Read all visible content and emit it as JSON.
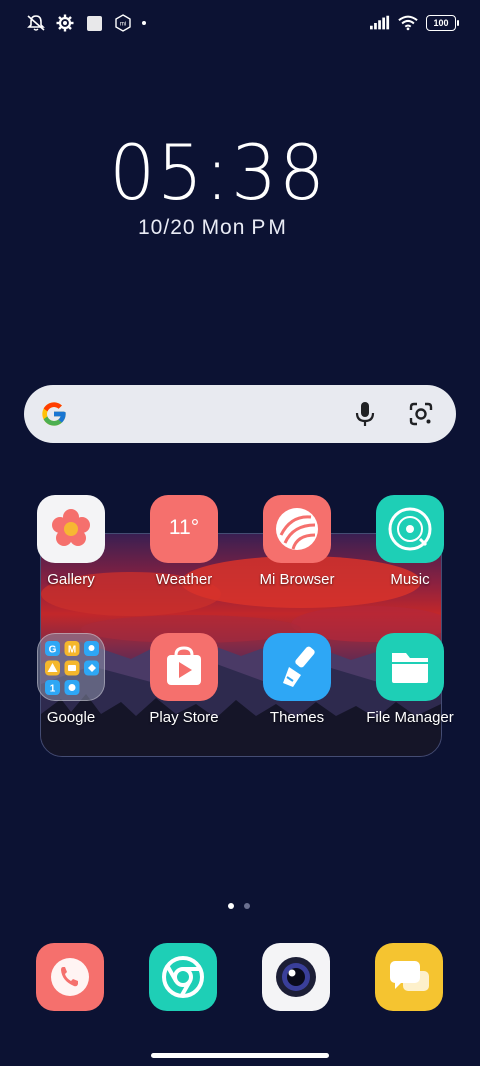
{
  "status_bar": {
    "battery": "100",
    "left_icons": [
      "notifications-muted-icon",
      "settings-gear-icon",
      "square-notification-icon",
      "mi-account-icon"
    ],
    "right_icons": [
      "cellular-signal-icon",
      "wifi-icon",
      "battery-icon"
    ]
  },
  "clock": {
    "time": "05:38",
    "date": "10/20",
    "day": "Mon",
    "period": "PM"
  },
  "search": {
    "icons": [
      "google-g-icon",
      "microphone-icon",
      "google-lens-icon"
    ]
  },
  "apps": [
    {
      "label": "Gallery",
      "icon": "gallery-flower-icon",
      "color": "#f4f4f6"
    },
    {
      "label": "Weather",
      "icon": "weather-icon",
      "color": "#f5706d",
      "value": "11°"
    },
    {
      "label": "Mi Browser",
      "icon": "browser-icon",
      "color": "#f5706d"
    },
    {
      "label": "Music",
      "icon": "music-disc-icon",
      "color": "#1ecfb6"
    },
    {
      "label": "Google",
      "icon": "folder-icon",
      "color": "#8c8fa8"
    },
    {
      "label": "Play Store",
      "icon": "play-store-icon",
      "color": "#f5706d"
    },
    {
      "label": "Themes",
      "icon": "brush-icon",
      "color": "#2ea7f5"
    },
    {
      "label": "File Manager",
      "icon": "folder-file-icon",
      "color": "#1ecfb6"
    }
  ],
  "dock": [
    {
      "name": "phone",
      "icon": "phone-icon",
      "color": "#f5706d"
    },
    {
      "name": "chrome",
      "icon": "chrome-icon",
      "color": "#1ecfb6"
    },
    {
      "name": "camera",
      "icon": "camera-icon",
      "color": "#f4f4f6"
    },
    {
      "name": "messages",
      "icon": "message-icon",
      "color": "#f5c430"
    }
  ],
  "pages": {
    "count": 2,
    "active": 1
  },
  "colors": {
    "background": "#0c1233",
    "coral": "#f5706d",
    "teal": "#1ecfb6",
    "blue": "#2ea7f5",
    "yellow": "#f5c430"
  }
}
